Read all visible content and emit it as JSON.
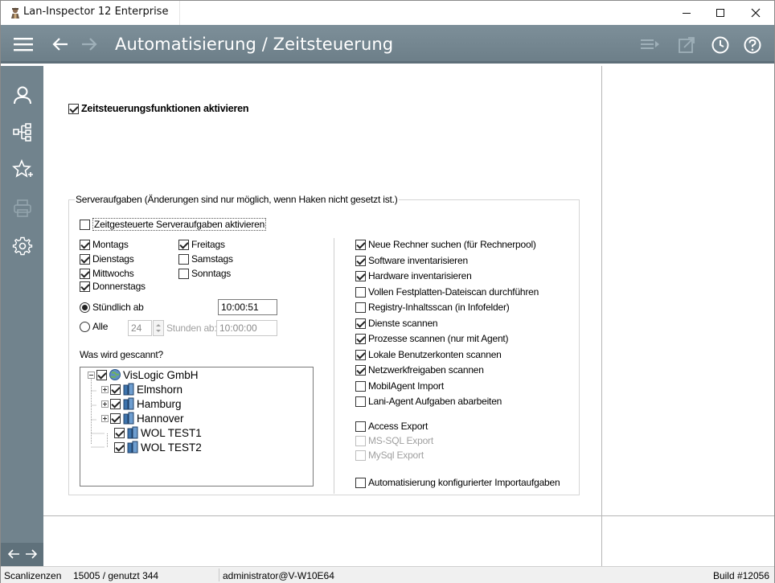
{
  "window": {
    "title": "Lan-Inspector 12 Enterprise",
    "controls": {
      "minimize": "minimize-icon",
      "maximize": "maximize-icon",
      "close": "close-icon"
    }
  },
  "toolbar": {
    "page_title": "Automatisierung / Zeitsteuerung",
    "icons": [
      "menu-icon",
      "back-arrow-icon",
      "forward-arrow-icon",
      "list-export-icon",
      "external-link-icon",
      "clock-icon",
      "help-icon"
    ]
  },
  "sidebar": {
    "items": [
      "user-icon",
      "network-tree-icon",
      "star-add-icon",
      "printer-icon",
      "settings-gear-icon"
    ]
  },
  "main": {
    "enable_scheduling": {
      "label": "Zeitsteuerungsfunktionen aktivieren",
      "checked": true
    },
    "server_tasks": {
      "legend": "Serveraufgaben (Änderungen sind nur möglich, wenn Haken nicht gesetzt ist.)",
      "enable_timed": {
        "label": "Zeitgesteuerte Serveraufgaben aktivieren",
        "checked": false
      },
      "days": [
        {
          "label": "Montags",
          "checked": true
        },
        {
          "label": "Dienstags",
          "checked": true
        },
        {
          "label": "Mittwochs",
          "checked": true
        },
        {
          "label": "Donnerstags",
          "checked": true
        },
        {
          "label": "Freitags",
          "checked": true
        },
        {
          "label": "Samstags",
          "checked": false
        },
        {
          "label": "Sonntags",
          "checked": false
        }
      ],
      "hourly": {
        "label": "Stündlich ab",
        "selected": true,
        "time": "10:00:51"
      },
      "every": {
        "label": "Alle",
        "selected": false,
        "hours": "24",
        "hours_label": "Stunden ab:",
        "time": "10:00:00"
      },
      "scan_label": "Was wird gescannt?",
      "tree": {
        "root": {
          "label": "VisLogic GmbH",
          "checked": true
        },
        "children": [
          {
            "label": "Elmshorn",
            "checked": true,
            "expandable": true
          },
          {
            "label": "Hamburg",
            "checked": true,
            "expandable": true
          },
          {
            "label": "Hannover",
            "checked": true,
            "expandable": true
          },
          {
            "label": "WOL TEST1",
            "checked": true,
            "expandable": false
          },
          {
            "label": "WOL TEST2",
            "checked": true,
            "expandable": false
          }
        ]
      },
      "tasks": [
        {
          "label": "Neue Rechner suchen (für Rechnerpool)",
          "checked": true,
          "enabled": true
        },
        {
          "label": "Software inventarisieren",
          "checked": true,
          "enabled": true
        },
        {
          "label": "Hardware inventarisieren",
          "checked": true,
          "enabled": true
        },
        {
          "label": "Vollen Festplatten-Dateiscan durchführen",
          "checked": false,
          "enabled": true
        },
        {
          "label": "Registry-Inhaltsscan (in Infofelder)",
          "checked": false,
          "enabled": true
        },
        {
          "label": "Dienste scannen",
          "checked": true,
          "enabled": true
        },
        {
          "label": "Prozesse scannen (nur mit Agent)",
          "checked": true,
          "enabled": true
        },
        {
          "label": "Lokale Benutzerkonten scannen",
          "checked": true,
          "enabled": true
        },
        {
          "label": "Netzwerkfreigaben scannen",
          "checked": true,
          "enabled": true
        },
        {
          "label": "MobilAgent Import",
          "checked": false,
          "enabled": true
        },
        {
          "label": "Lani-Agent Aufgaben abarbeiten",
          "checked": false,
          "enabled": true
        },
        {
          "label": "Access Export",
          "checked": false,
          "enabled": true
        },
        {
          "label": "MS-SQL Export",
          "checked": false,
          "enabled": false
        },
        {
          "label": "MySql Export",
          "checked": false,
          "enabled": false
        },
        {
          "label": "Automatisierung konfigurierter Importaufgaben",
          "checked": false,
          "enabled": true
        }
      ]
    }
  },
  "statusbar": {
    "licenses_label": "Scanlizenzen",
    "licenses_value": "15005 / genutzt 344",
    "user": "administrator@V-W10E64",
    "build": "Build #12056"
  }
}
